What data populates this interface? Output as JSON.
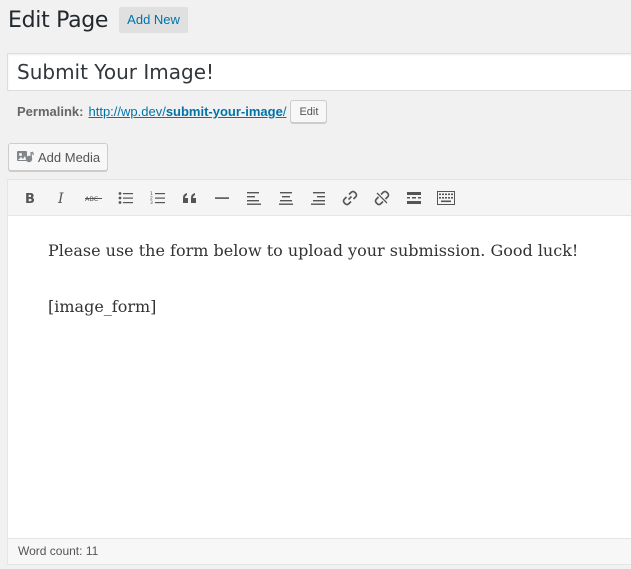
{
  "header": {
    "title": "Edit Page",
    "add_new_label": "Add New"
  },
  "post": {
    "title_value": "Submit Your Image!"
  },
  "permalink": {
    "label": "Permalink:",
    "url_prefix": "http://wp.dev/",
    "slug": "submit-your-image",
    "url_suffix": "/",
    "edit_label": "Edit"
  },
  "media": {
    "add_media_label": "Add Media",
    "icon": "add-media-icon"
  },
  "toolbar": {
    "buttons": [
      {
        "name": "bold",
        "icon": "bold-icon"
      },
      {
        "name": "italic",
        "icon": "italic-icon"
      },
      {
        "name": "strikethrough",
        "icon": "strikethrough-icon"
      },
      {
        "name": "bullet-list",
        "icon": "bullet-list-icon"
      },
      {
        "name": "numbered-list",
        "icon": "numbered-list-icon"
      },
      {
        "name": "blockquote",
        "icon": "blockquote-icon"
      },
      {
        "name": "horizontal-line",
        "icon": "horizontal-line-icon"
      },
      {
        "name": "align-left",
        "icon": "align-left-icon"
      },
      {
        "name": "align-center",
        "icon": "align-center-icon"
      },
      {
        "name": "align-right",
        "icon": "align-right-icon"
      },
      {
        "name": "insert-link",
        "icon": "link-icon"
      },
      {
        "name": "remove-link",
        "icon": "unlink-icon"
      },
      {
        "name": "read-more",
        "icon": "read-more-icon"
      },
      {
        "name": "toolbar-toggle",
        "icon": "kitchen-sink-icon"
      }
    ]
  },
  "content": {
    "paragraph_1": "Please use the form below to upload your submission. Good luck!",
    "paragraph_2": "[image_form]"
  },
  "status": {
    "word_count_label": "Word count:",
    "word_count": "11"
  }
}
